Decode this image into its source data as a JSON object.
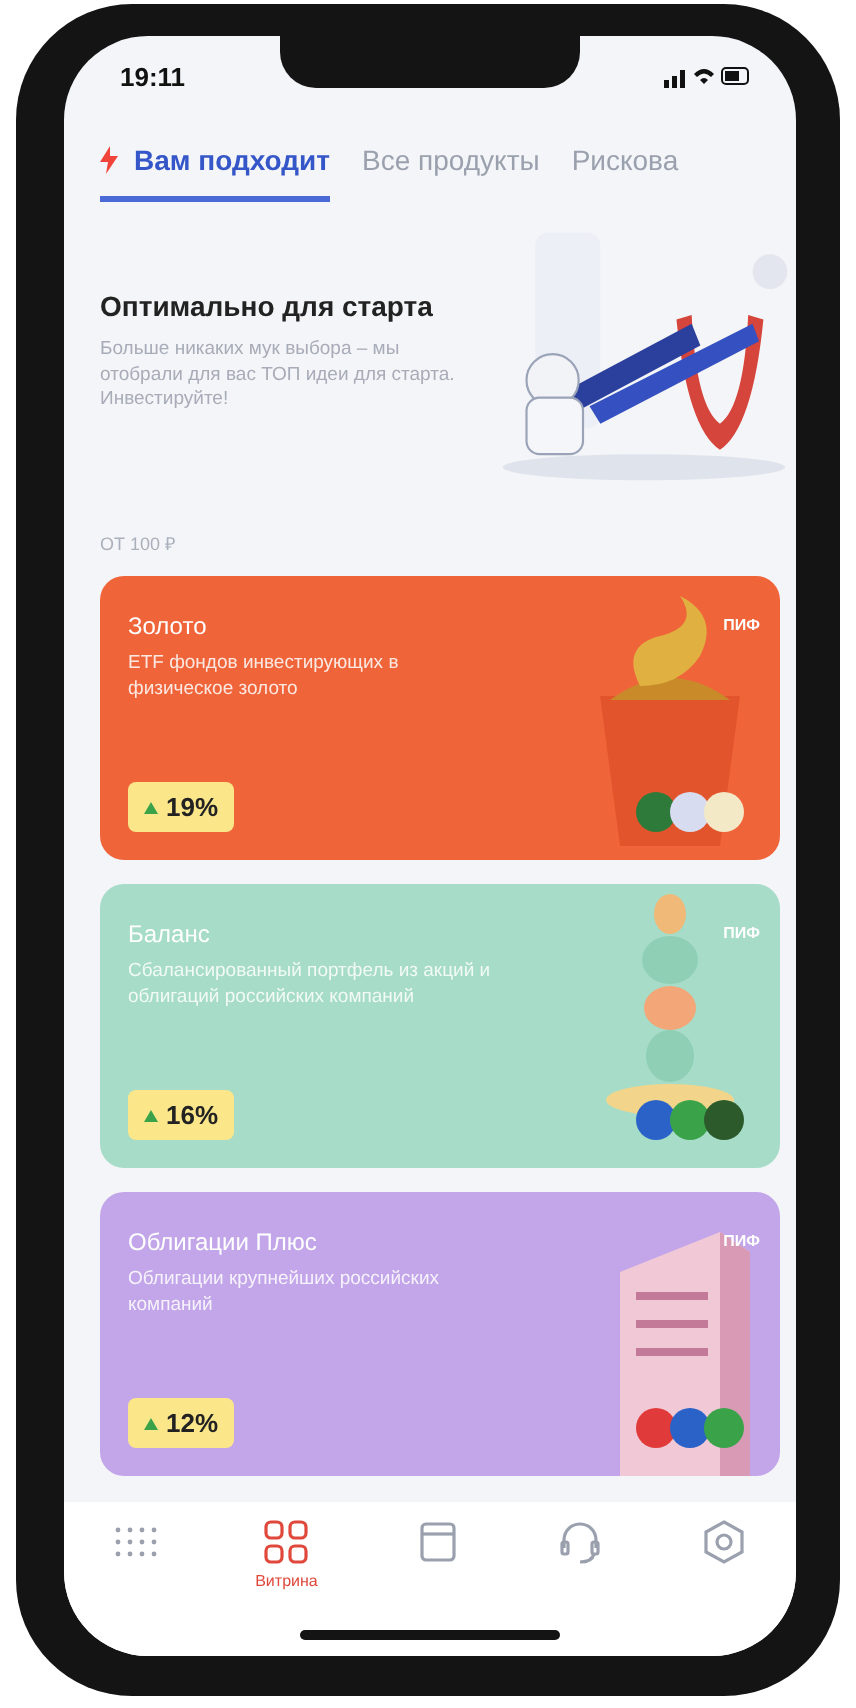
{
  "status_bar": {
    "time": "19:11"
  },
  "tabs": [
    {
      "label": "Вам подходит",
      "selected": true,
      "kind": "featured"
    },
    {
      "label": "Все продукты",
      "selected": false,
      "kind": "plain"
    },
    {
      "label": "Рискова",
      "selected": false,
      "kind": "plain"
    }
  ],
  "hero": {
    "title": "Оптимально для старта",
    "text": "Больше никаких мук выбора – мы отобрали для вас ТОП идеи для старта. Инвестируйте!"
  },
  "section_label": "ОТ 100 ₽",
  "cards": [
    {
      "title": "Золото",
      "description": "ETF фондов инвестирующих в физическое золото",
      "badge": "ПИФ",
      "return": "19%",
      "color": "#f0643a",
      "kind": "dessert"
    },
    {
      "title": "Баланс",
      "description": "Сбалансированный портфель из акций и облигаций российских компаний",
      "badge": "ПИФ",
      "return": "16%",
      "color": "#a6dcc8",
      "kind": "stones"
    },
    {
      "title": "Облигации Плюс",
      "description": "Облигации крупнейших российских компаний",
      "badge": "ПИФ",
      "return": "12%",
      "color": "#c3a6ea",
      "kind": "building"
    }
  ],
  "nav": [
    {
      "selected": false
    },
    {
      "label": "Витрина",
      "selected": true
    },
    {
      "selected": false
    },
    {
      "selected": false
    },
    {
      "selected": false
    }
  ]
}
